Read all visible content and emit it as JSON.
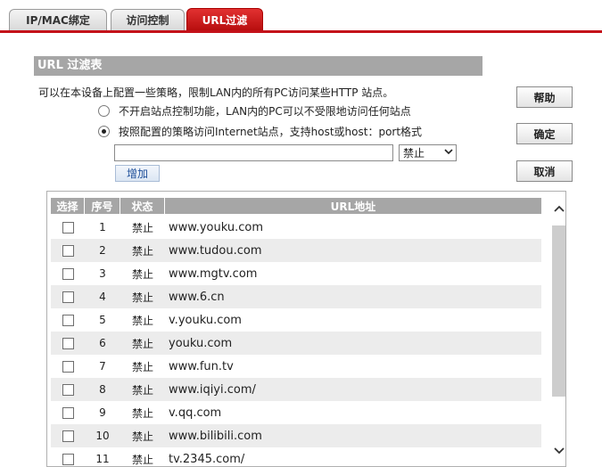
{
  "tabs": [
    {
      "label": "IP/MAC绑定",
      "active": false
    },
    {
      "label": "访问控制",
      "active": false
    },
    {
      "label": "URL过滤",
      "active": true
    }
  ],
  "section": {
    "title": "URL 过滤表",
    "description": "可以在本设备上配置一些策略，限制LAN内的所有PC访问某些HTTP 站点。",
    "option_disable": "不开启站点控制功能，LAN内的PC可以不受限地访问任何站点",
    "option_policy": "按照配置的策略访问Internet站点，支持host或host：port格式"
  },
  "form": {
    "url_input_value": "",
    "status_selected": "禁止",
    "add_label": "增加"
  },
  "buttons": {
    "help": "帮助",
    "ok": "确定",
    "cancel": "取消"
  },
  "table": {
    "headers": {
      "select": "选择",
      "number": "序号",
      "status": "状态",
      "url": "URL地址"
    },
    "rows": [
      {
        "num": "1",
        "status": "禁止",
        "url": "www.youku.com"
      },
      {
        "num": "2",
        "status": "禁止",
        "url": "www.tudou.com"
      },
      {
        "num": "3",
        "status": "禁止",
        "url": "www.mgtv.com"
      },
      {
        "num": "4",
        "status": "禁止",
        "url": "www.6.cn"
      },
      {
        "num": "5",
        "status": "禁止",
        "url": "v.youku.com"
      },
      {
        "num": "6",
        "status": "禁止",
        "url": "youku.com"
      },
      {
        "num": "7",
        "status": "禁止",
        "url": "www.fun.tv"
      },
      {
        "num": "8",
        "status": "禁止",
        "url": "www.iqiyi.com/"
      },
      {
        "num": "9",
        "status": "禁止",
        "url": "v.qq.com"
      },
      {
        "num": "10",
        "status": "禁止",
        "url": "www.bilibili.com"
      },
      {
        "num": "11",
        "status": "禁止",
        "url": "tv.2345.com/"
      }
    ]
  },
  "icons": {
    "scroll_up": "chevron-up-icon",
    "scroll_down": "chevron-down-icon",
    "select_arrow": "chevron-down-icon"
  },
  "colors": {
    "accent_red": "#c4121a",
    "header_gray": "#a6a6a6"
  }
}
